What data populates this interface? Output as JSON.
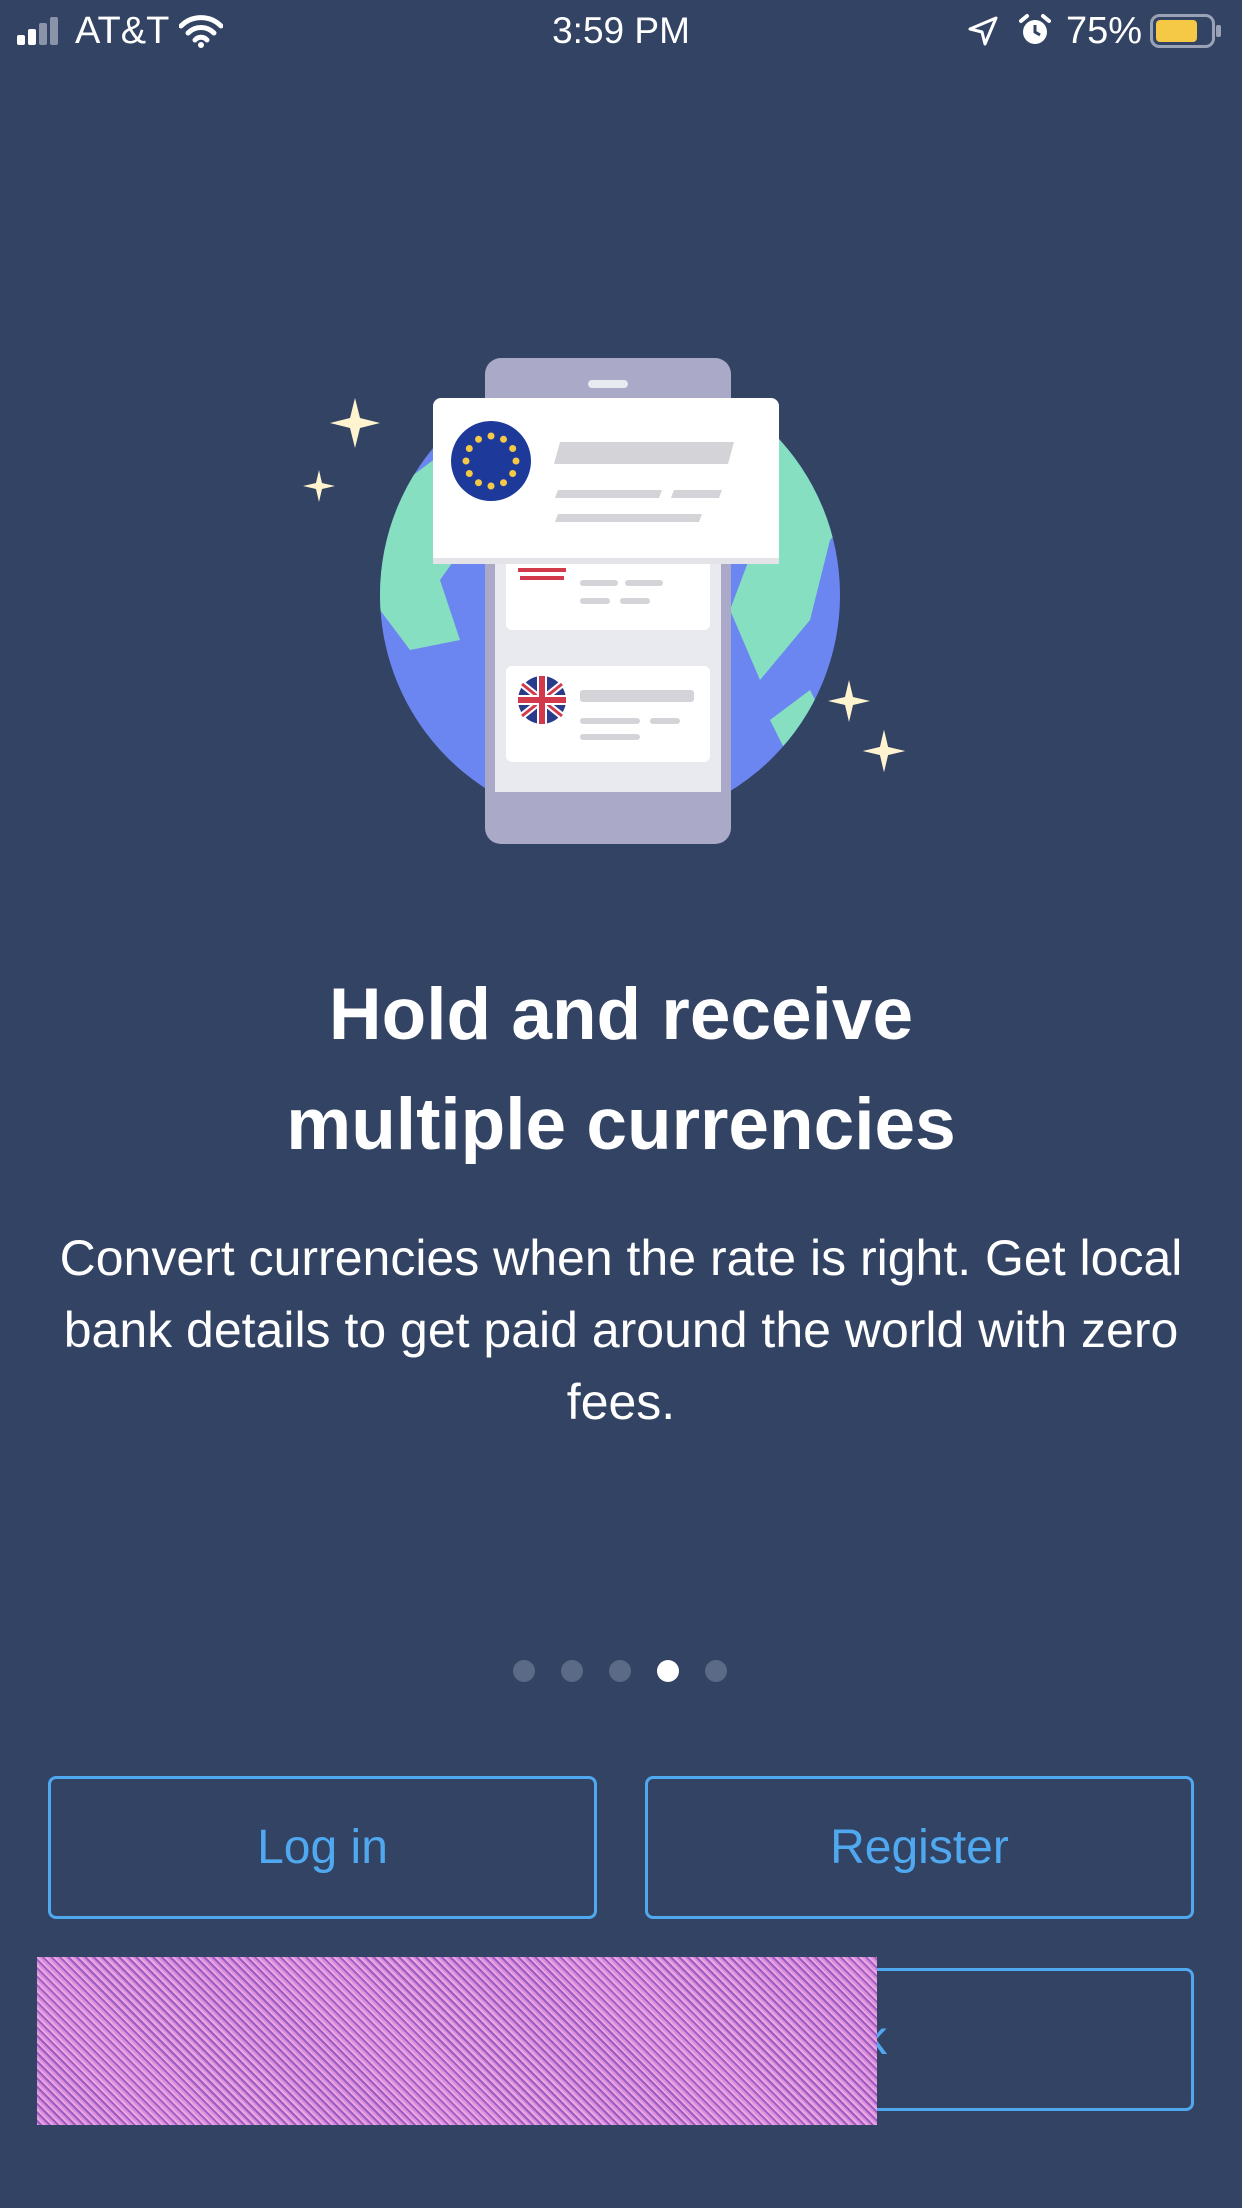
{
  "status_bar": {
    "carrier": "AT&T",
    "time": "3:59 PM",
    "battery_percent": "75%",
    "icons": [
      "signal-icon",
      "wifi-icon",
      "location-icon",
      "alarm-icon",
      "battery-icon"
    ],
    "battery_color": "#f5c846"
  },
  "onboarding": {
    "headline_line1": "Hold and receive",
    "headline_line2": "multiple currencies",
    "body": "Convert currencies when the rate is right. Get local bank details to get paid around the world with zero fees.",
    "pagination": {
      "total": 5,
      "active_index": 3
    }
  },
  "actions": {
    "login_label": "Log in",
    "register_label": "Register",
    "third_label_visible": "k"
  },
  "colors": {
    "background": "#334363",
    "accent": "#4fa8f0",
    "globe_blue": "#6b86f0",
    "land_green": "#86dfc0"
  }
}
